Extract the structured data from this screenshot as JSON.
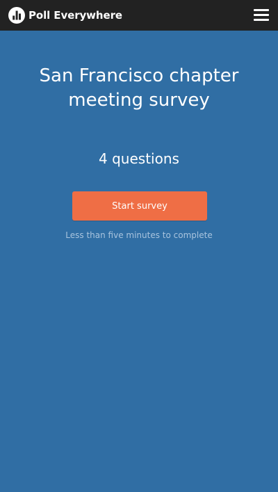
{
  "header": {
    "brand_name": "Poll Everywhere",
    "logo_icon": "poll-everywhere-logo-icon",
    "menu_icon": "hamburger-menu-icon"
  },
  "survey": {
    "title": "San Francisco chapter meeting survey",
    "question_count": "4 questions",
    "start_label": "Start survey",
    "completion_note": "Less than five minutes to complete"
  },
  "colors": {
    "header_background": "#222222",
    "page_background": "#306ea4",
    "button_background": "#ef6e45",
    "note_text": "#a9c4de"
  }
}
